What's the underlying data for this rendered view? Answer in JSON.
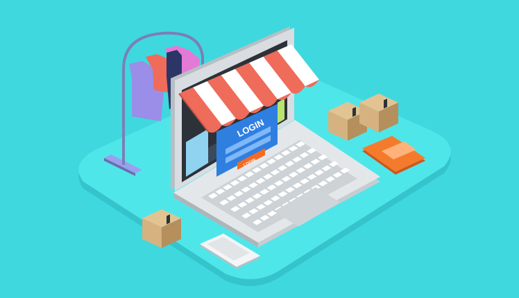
{
  "scene": {
    "title_text": "LOGIN",
    "button_text": "LOGIN"
  },
  "colors": {
    "background": "#3fd8df",
    "platform": "#4fe6ea",
    "platform_shadow": "#35c4cc",
    "laptop_body": "#dfe3e6",
    "laptop_dark": "#b9c0c5",
    "screen_frame": "#2c3238",
    "awning_red": "#ef6b5a",
    "awning_white": "#ffffff",
    "login_panel": "#2f7fe0",
    "login_button": "#f36b24",
    "box": "#d5b27f",
    "box_dark": "#b58f5c",
    "card": "#f47b2c",
    "rack": "#7b7fb8",
    "shirt_purple": "#9a8ee8",
    "shirt_pink": "#e57ad6",
    "shirt_red": "#ef6b5a",
    "shirt_navy": "#2b3566"
  },
  "icons": [
    "laptop-icon",
    "shop-awning-icon",
    "clothes-rack-icon",
    "parcel-box-icon",
    "credit-card-icon",
    "tablet-icon"
  ]
}
